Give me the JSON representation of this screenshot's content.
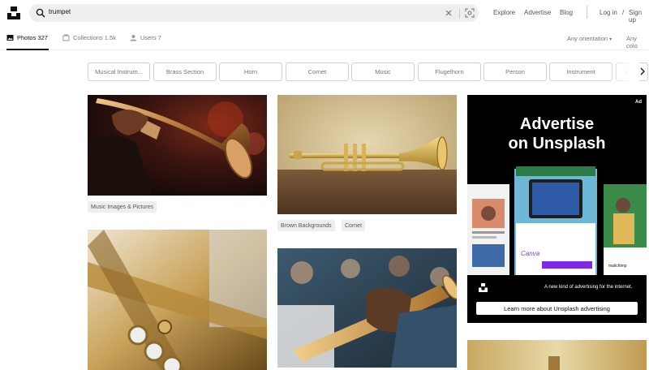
{
  "header": {
    "search_value": "trumpet",
    "nav": {
      "explore": "Explore",
      "advertise": "Advertise",
      "blog": "Blog",
      "login": "Log in",
      "slash": "/",
      "signup": "Sign up"
    }
  },
  "tabs": {
    "photos": "Photos 327",
    "collections": "Collections 1.5k",
    "users": "Users 7",
    "orientation": "Any orientation",
    "color": "Any colo"
  },
  "chips": [
    "Musical Instrum...",
    "Brass Section",
    "Horn",
    "Cornet",
    "Music",
    "Flugelhorn",
    "Person",
    "Instrument",
    "Le..."
  ],
  "photo_tags": {
    "p1": [
      "Music Images & Pictures"
    ],
    "p2": [
      "Brown Backgrounds",
      "Cornet"
    ]
  },
  "ad": {
    "label": "Ad",
    "title_line1": "Advertise",
    "title_line2": "on Unsplash",
    "tagline": "A new kind of advertising for the internet.",
    "button": "Learn more about Unsplash advertising",
    "mock_canva": "Canva",
    "mock_mailchimp": "mailchimp"
  },
  "colors": {
    "accent": "#111111",
    "chip_border": "#d1d1d1",
    "ad_bg": "#000000",
    "search_bg": "#eeeeee"
  }
}
